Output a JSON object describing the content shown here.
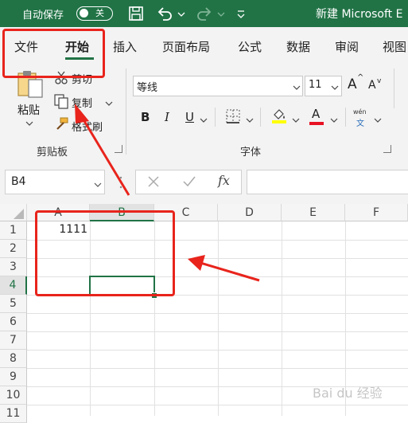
{
  "titlebar": {
    "autosave_label": "自动保存",
    "autosave_toggle": "关",
    "doc_title": "新建 Microsoft E",
    "icons": [
      "save-icon",
      "undo-icon",
      "redo-icon",
      "customize-icon"
    ]
  },
  "tabs": [
    {
      "label": "文件"
    },
    {
      "label": "开始",
      "active": true
    },
    {
      "label": "插入"
    },
    {
      "label": "页面布局"
    },
    {
      "label": "公式"
    },
    {
      "label": "数据"
    },
    {
      "label": "审阅"
    },
    {
      "label": "视图"
    }
  ],
  "clipboard": {
    "paste_label": "粘贴",
    "cut_label": "剪切",
    "copy_label": "复制",
    "format_painter_label": "格式刷",
    "group_label": "剪贴板"
  },
  "font": {
    "font_name": "等线",
    "font_size": "11",
    "bold": "B",
    "italic": "I",
    "underline": "U",
    "font_color_letter": "A",
    "wen_label": "wén",
    "wen_char": "文",
    "grow_label": "A",
    "shrink_label": "A",
    "group_label": "字体"
  },
  "formula_bar": {
    "name_box": "B4",
    "fx_label": "fx",
    "formula": ""
  },
  "sheet": {
    "columns": [
      "A",
      "B",
      "C",
      "D",
      "E",
      "F"
    ],
    "selected_column": "B",
    "rows": [
      "1",
      "2",
      "3",
      "4",
      "5",
      "6",
      "7",
      "8",
      "9",
      "10",
      "11"
    ],
    "selected_row": "4",
    "cells": {
      "A1": "1111"
    },
    "active_cell": "B4"
  },
  "watermark": "Bai du 经验",
  "colors": {
    "accent": "#217346",
    "annotation": "#e8241c",
    "highlight_yellow": "#ffff00",
    "font_red": "#e81123"
  }
}
